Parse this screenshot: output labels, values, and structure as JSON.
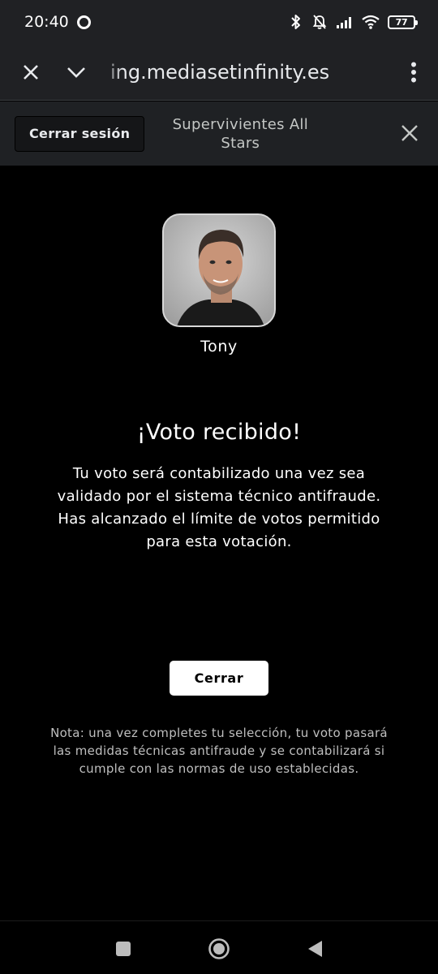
{
  "status_bar": {
    "time": "20:40",
    "battery": "77"
  },
  "browser": {
    "url": "ing.mediasetinfinity.es",
    "icons": [
      "close-icon",
      "chevron-down-icon",
      "more-vert-icon"
    ]
  },
  "sub_header": {
    "logout_label": "Cerrar sesión",
    "title": "Supervivientes All Stars"
  },
  "candidate": {
    "name": "Tony"
  },
  "confirmation": {
    "headline": "¡Voto recibido!",
    "message": "Tu voto será contabilizado una vez sea validado por el sistema técnico antifraude. Has alcanzado el límite de votos permitido para esta votación.",
    "close_label": "Cerrar",
    "note": "Nota: una vez completes tu selección, tu voto pasará las medidas técnicas antifraude y se contabilizará si cumple con las normas de uso establecidas."
  },
  "colors": {
    "background": "#000000",
    "toolbar": "#202124",
    "sub_header": "#1f2124",
    "button_bg": "#ffffff"
  }
}
